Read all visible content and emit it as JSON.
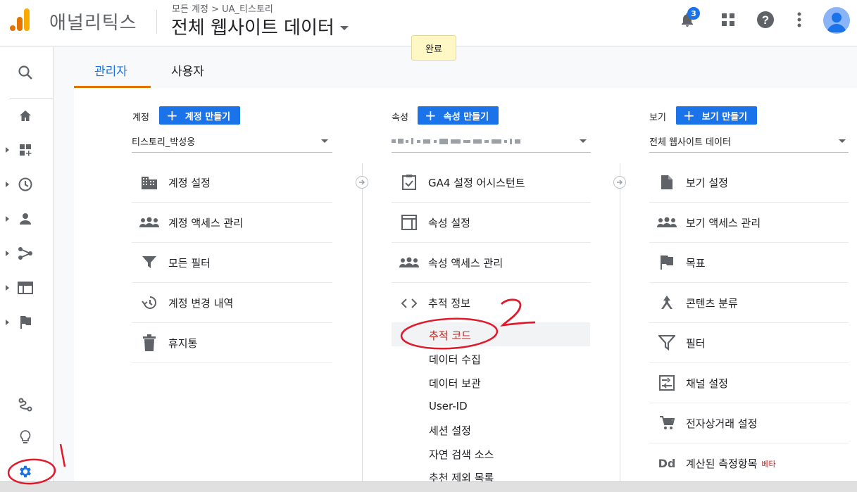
{
  "header": {
    "app_name": "애널리틱스",
    "breadcrumb": "모든 계정 > UA_티스토리",
    "view_title": "전체 웹사이트 데이터",
    "notification_count": "3"
  },
  "tooltip": {
    "done": "완료"
  },
  "tabs": [
    {
      "label": "관리자",
      "active": true
    },
    {
      "label": "사용자",
      "active": false
    }
  ],
  "account_column": {
    "label": "계정",
    "create_button": "계정 만들기",
    "selected": "티스토리_박성웅",
    "items": [
      "계정 설정",
      "계정 액세스 관리",
      "모든 필터",
      "계정 변경 내역",
      "휴지통"
    ]
  },
  "property_column": {
    "label": "속성",
    "create_button": "속성 만들기",
    "items": [
      "GA4 설정 어시스턴트",
      "속성 설정",
      "속성 액세스 관리",
      "추적 정보"
    ],
    "sub_items": [
      "추적 코드",
      "데이터 수집",
      "데이터 보관",
      "User-ID",
      "세션 설정",
      "자연 검색 소스",
      "추천 제외 목록"
    ]
  },
  "view_column": {
    "label": "보기",
    "create_button": "보기 만들기",
    "selected": "전체 웹사이트 데이터",
    "items": [
      "보기 설정",
      "보기 액세스 관리",
      "목표",
      "콘텐츠 분류",
      "필터",
      "채널 설정",
      "전자상거래 설정",
      "계산된 측정항목"
    ],
    "beta_label": "베타"
  },
  "annotations": {
    "one": "1",
    "two": "2"
  },
  "colors": {
    "primary": "#1a73e8",
    "accent": "#e37400",
    "annotation": "#e0192b"
  }
}
